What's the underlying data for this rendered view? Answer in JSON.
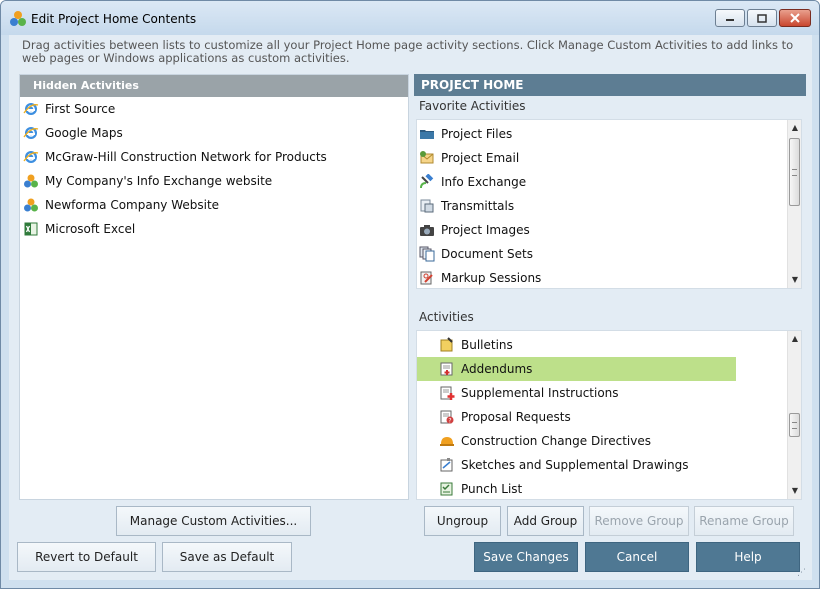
{
  "window": {
    "title": "Edit Project Home Contents"
  },
  "instructions": "Drag activities between lists to customize all your Project Home page activity sections.  Click Manage Custom Activities to add links to web pages or Windows applications as custom activities.",
  "hidden": {
    "header": "Hidden Activities",
    "items": [
      {
        "label": "First Source",
        "icon": "ie-icon"
      },
      {
        "label": "Google Maps",
        "icon": "ie-icon"
      },
      {
        "label": "McGraw-Hill Construction Network for Products",
        "icon": "ie-icon"
      },
      {
        "label": "My Company's Info Exchange website",
        "icon": "newforma-icon"
      },
      {
        "label": "Newforma Company Website",
        "icon": "newforma-icon"
      },
      {
        "label": "Microsoft Excel",
        "icon": "excel-icon"
      }
    ]
  },
  "project_home": {
    "header": "PROJECT HOME",
    "favorites_label": "Favorite Activities",
    "favorites": [
      {
        "label": "Project Files",
        "icon": "folder-icon"
      },
      {
        "label": "Project Email",
        "icon": "email-icon"
      },
      {
        "label": "Info Exchange",
        "icon": "satellite-icon"
      },
      {
        "label": "Transmittals",
        "icon": "transmittal-icon"
      },
      {
        "label": "Project Images",
        "icon": "camera-icon"
      },
      {
        "label": "Document Sets",
        "icon": "document-sets-icon"
      },
      {
        "label": "Markup Sessions",
        "icon": "markup-icon"
      }
    ],
    "activities_label": "Activities",
    "activities": [
      {
        "label": "Bulletins",
        "icon": "bulletin-icon"
      },
      {
        "label": "Addendums",
        "icon": "addendum-icon",
        "selected": true
      },
      {
        "label": "Supplemental Instructions",
        "icon": "supplemental-icon"
      },
      {
        "label": "Proposal Requests",
        "icon": "proposal-icon"
      },
      {
        "label": "Construction Change Directives",
        "icon": "hardhat-icon"
      },
      {
        "label": "Sketches and Supplemental Drawings",
        "icon": "sketch-icon"
      },
      {
        "label": "Punch List",
        "icon": "punchlist-icon"
      }
    ]
  },
  "buttons": {
    "manage_custom": "Manage Custom Activities...",
    "ungroup": "Ungroup",
    "add_group": "Add Group",
    "remove_group": "Remove Group",
    "rename_group": "Rename Group",
    "revert_default": "Revert to Default",
    "save_as_default": "Save as Default",
    "save_changes": "Save Changes",
    "cancel": "Cancel",
    "help": "Help"
  },
  "colors": {
    "header_right": "#5d7d93",
    "header_left": "#9aa3a8",
    "selection": "#bde08a",
    "primary_button": "#4f7893"
  }
}
